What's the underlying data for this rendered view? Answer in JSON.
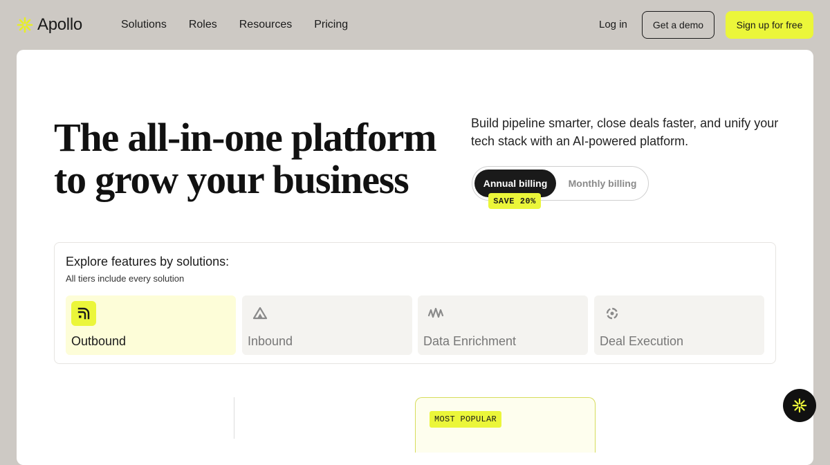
{
  "brand": {
    "name": "Apollo",
    "logo_icon": "apollo-asterisk-icon",
    "accent_color": "#ebf63a"
  },
  "nav": {
    "links": [
      "Solutions",
      "Roles",
      "Resources",
      "Pricing"
    ],
    "login": "Log in",
    "demo": "Get a demo",
    "signup": "Sign up for free"
  },
  "hero": {
    "title_line1": "The all-in-one platform",
    "title_line2": "to grow your business",
    "subtitle": "Build pipeline smarter, close deals faster, and unify your tech stack with an AI-powered platform."
  },
  "billing": {
    "annual": "Annual billing",
    "monthly": "Monthly billing",
    "selected": "Annual billing",
    "save_badge": "SAVE 20%"
  },
  "features": {
    "title": "Explore features by solutions:",
    "subtitle": "All tiers include every solution",
    "tiles": [
      {
        "label": "Outbound",
        "icon": "outbound-signal-icon",
        "active": true
      },
      {
        "label": "Inbound",
        "icon": "inbound-triangle-icon",
        "active": false
      },
      {
        "label": "Data Enrichment",
        "icon": "data-enrichment-wave-icon",
        "active": false
      },
      {
        "label": "Deal Execution",
        "icon": "deal-execution-circle-icon",
        "active": false
      }
    ]
  },
  "pricing_preview": {
    "badge": "MOST POPULAR"
  },
  "chat": {
    "icon": "apollo-asterisk-icon"
  }
}
